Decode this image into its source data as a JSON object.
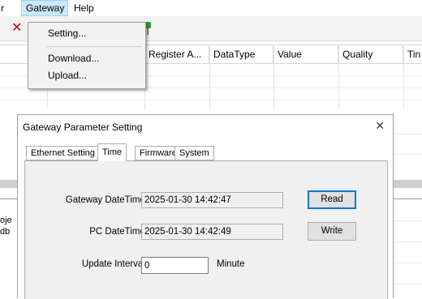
{
  "menubar": {
    "items": [
      {
        "label": "r"
      },
      {
        "label": "Gateway"
      },
      {
        "label": "Help"
      }
    ]
  },
  "toolbar": {
    "delete_icon": "✕",
    "pin_icon": "green-pin-icon"
  },
  "gateway_menu": {
    "items": [
      {
        "label": "Setting..."
      },
      {
        "label": "Download..."
      },
      {
        "label": "Upload..."
      }
    ]
  },
  "grid": {
    "columns": [
      "Register A...",
      "DataType",
      "Value",
      "Quality",
      "Tin"
    ]
  },
  "left_pane": {
    "lines": [
      "oje",
      "db"
    ]
  },
  "dialog": {
    "title": "Gateway Parameter Setting",
    "close_glyph": "✕",
    "tabs": [
      {
        "label": "Ethernet Setting",
        "selected": false
      },
      {
        "label": "Time",
        "selected": true
      },
      {
        "label": "Firmware",
        "selected": false
      },
      {
        "label": "System",
        "selected": false
      }
    ],
    "time_tab": {
      "gateway_datetime_label": "Gateway DateTime:",
      "gateway_datetime_value": "2025-01-30 14:42:47",
      "pc_datetime_label": "PC DateTime:",
      "pc_datetime_value": "2025-01-30 14:42:49",
      "update_interval_label": "Update Interval:",
      "update_interval_value": "0",
      "update_interval_unit": "Minute",
      "read_button": "Read",
      "write_button": "Write"
    }
  },
  "colors": {
    "menu_highlight": "#cce8ff",
    "default_button_border": "#0078d7",
    "panel_background": "#f0f0f0"
  }
}
